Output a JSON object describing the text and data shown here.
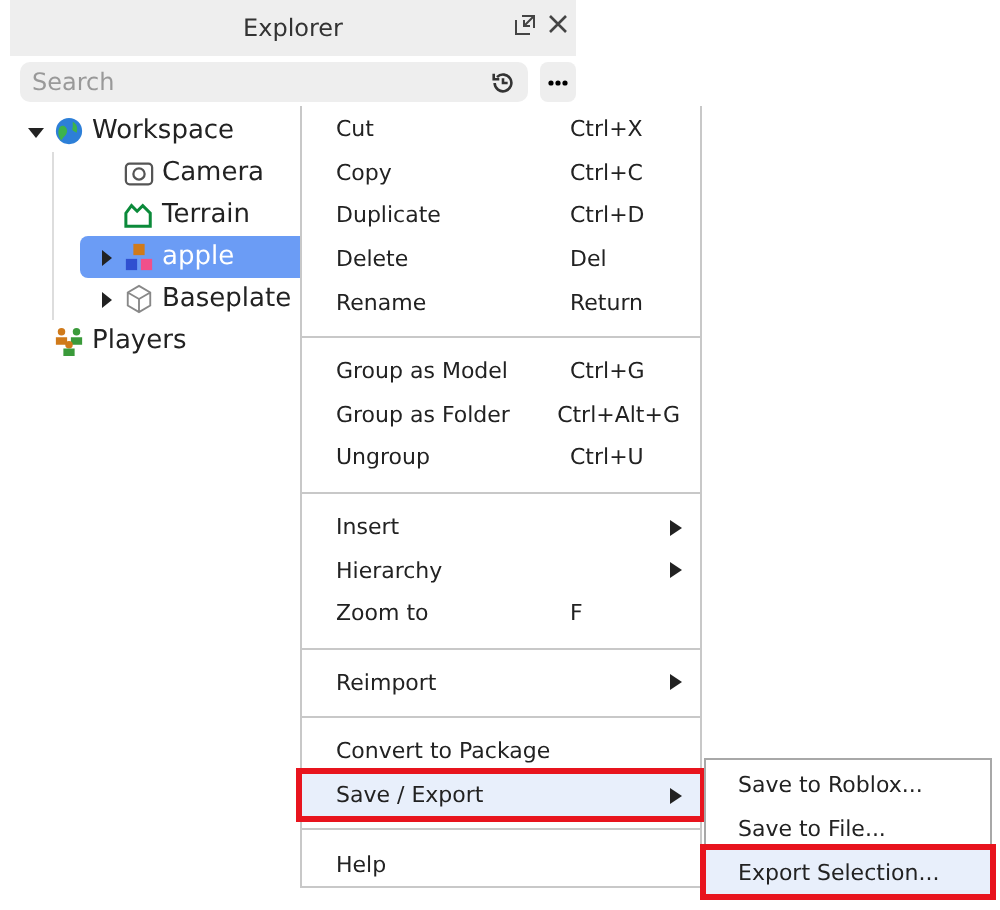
{
  "window": {
    "title": "Explorer"
  },
  "search": {
    "placeholder": "Search"
  },
  "tree": [
    {
      "label": "Workspace",
      "kind": "workspace",
      "expanded": true,
      "selected": false,
      "children": [
        {
          "label": "Camera",
          "kind": "camera",
          "selected": false
        },
        {
          "label": "Terrain",
          "kind": "terrain",
          "selected": false
        },
        {
          "label": "apple",
          "kind": "model",
          "expanded": false,
          "selected": true
        },
        {
          "label": "Baseplate",
          "kind": "part",
          "expanded": false,
          "selected": false
        }
      ]
    },
    {
      "label": "Players",
      "kind": "players",
      "selected": false
    }
  ],
  "context_menu": [
    {
      "kind": "item",
      "label": "Cut",
      "shortcut": "Ctrl+X"
    },
    {
      "kind": "item",
      "label": "Copy",
      "shortcut": "Ctrl+C"
    },
    {
      "kind": "item",
      "label": "Duplicate",
      "shortcut": "Ctrl+D"
    },
    {
      "kind": "item",
      "label": "Delete",
      "shortcut": "Del"
    },
    {
      "kind": "item",
      "label": "Rename",
      "shortcut": "Return"
    },
    {
      "kind": "separator"
    },
    {
      "kind": "item",
      "label": "Group as Model",
      "shortcut": "Ctrl+G"
    },
    {
      "kind": "item",
      "label": "Group as Folder",
      "shortcut": "Ctrl+Alt+G"
    },
    {
      "kind": "item",
      "label": "Ungroup",
      "shortcut": "Ctrl+U"
    },
    {
      "kind": "separator"
    },
    {
      "kind": "submenu",
      "label": "Insert"
    },
    {
      "kind": "submenu",
      "label": "Hierarchy"
    },
    {
      "kind": "item",
      "label": "Zoom to",
      "shortcut": "F"
    },
    {
      "kind": "separator"
    },
    {
      "kind": "submenu",
      "label": "Reimport"
    },
    {
      "kind": "separator"
    },
    {
      "kind": "item",
      "label": "Convert to Package"
    },
    {
      "kind": "submenu",
      "label": "Save / Export",
      "selected": true,
      "highlighted": true
    },
    {
      "kind": "separator"
    },
    {
      "kind": "item",
      "label": "Help"
    }
  ],
  "submenu": [
    {
      "label": "Save to Roblox...",
      "selected": false,
      "highlighted": false
    },
    {
      "label": "Save to File...",
      "selected": false,
      "highlighted": false
    },
    {
      "label": "Export Selection...",
      "selected": true,
      "highlighted": true
    }
  ]
}
